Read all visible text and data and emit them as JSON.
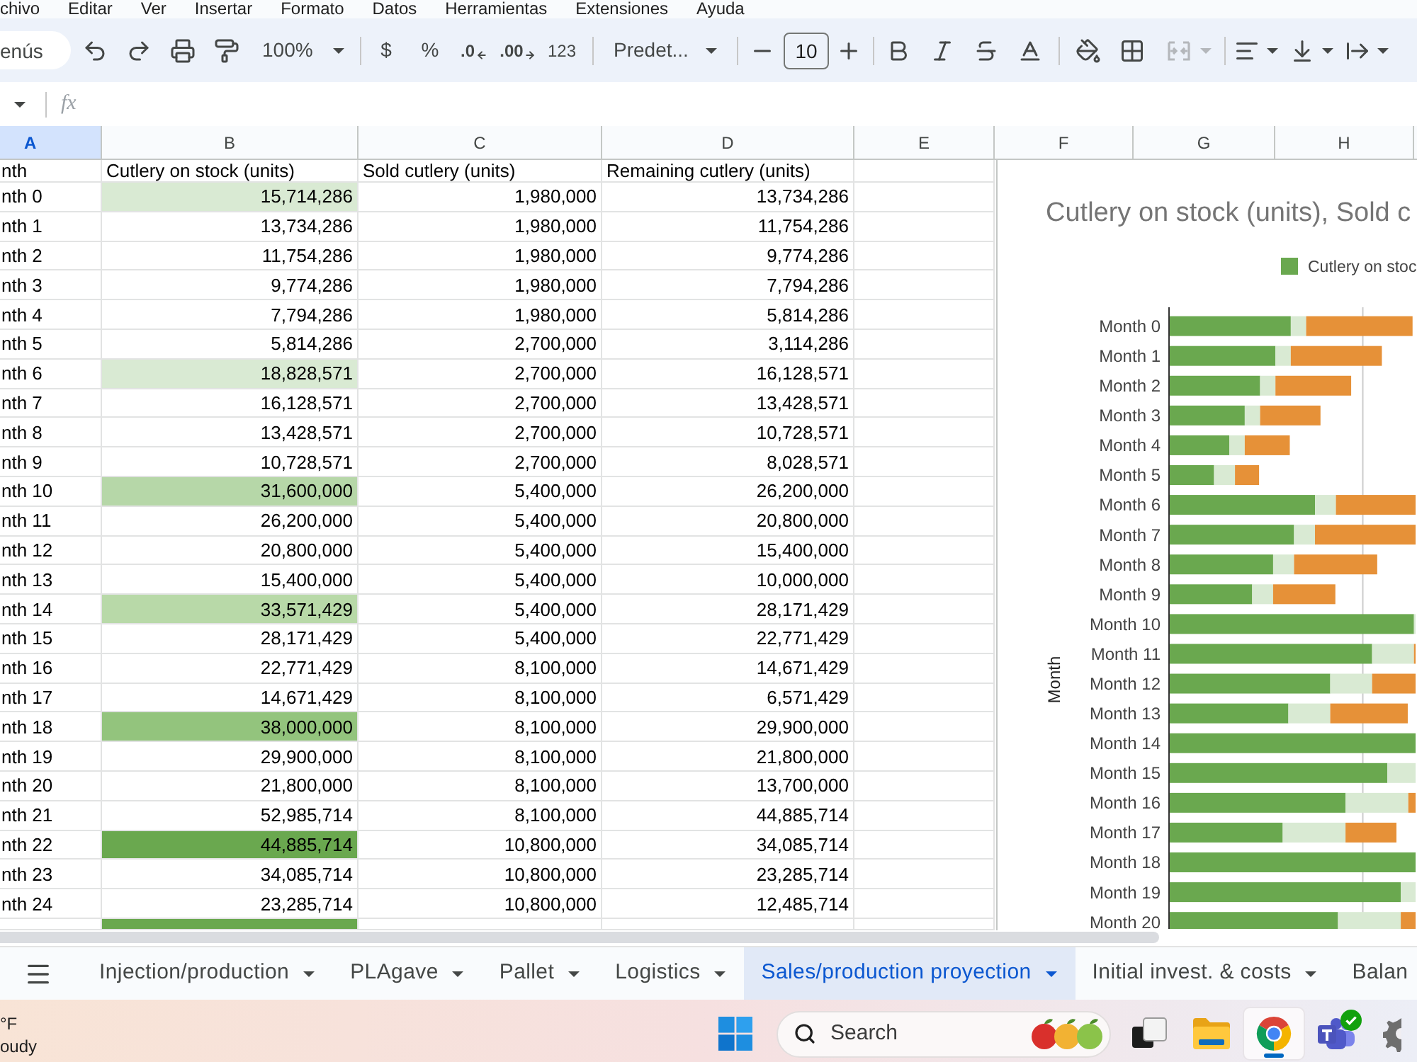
{
  "menu_bar": {
    "items": [
      "chivo",
      "Editar",
      "Ver",
      "Insertar",
      "Formato",
      "Datos",
      "Herramientas",
      "Extensiones",
      "Ayuda"
    ]
  },
  "toolbar": {
    "search": {
      "placeholder": "enús"
    },
    "zoom": "100%",
    "currency": "$",
    "percent": "%",
    "decrease_decimals": ".0",
    "increase_decimals": ".00",
    "number_format": "123",
    "font": "Predet...",
    "font_size": "10",
    "merge": {
      "disabled": true
    }
  },
  "formula_bar": {
    "label": "fx"
  },
  "sheet": {
    "columns": [
      {
        "label": "A",
        "selected": true
      },
      {
        "label": "B",
        "selected": false
      },
      {
        "label": "C",
        "selected": false
      },
      {
        "label": "D",
        "selected": false
      },
      {
        "label": "E",
        "selected": false
      },
      {
        "label": "F",
        "selected": false
      },
      {
        "label": "G",
        "selected": false
      },
      {
        "label": "H",
        "selected": false
      }
    ],
    "header": [
      "nth",
      "Cutlery on stock (units)",
      "Sold cutlery (units)",
      "Remaining cutlery (units)"
    ],
    "rows": [
      {
        "month": "nth 0",
        "stock": "15,714,286",
        "sold": "1,980,000",
        "remaining": "13,734,286",
        "color": "#d9ead3"
      },
      {
        "month": "nth 1",
        "stock": "13,734,286",
        "sold": "1,980,000",
        "remaining": "11,754,286"
      },
      {
        "month": "nth 2",
        "stock": "11,754,286",
        "sold": "1,980,000",
        "remaining": "9,774,286"
      },
      {
        "month": "nth 3",
        "stock": "9,774,286",
        "sold": "1,980,000",
        "remaining": "7,794,286"
      },
      {
        "month": "nth 4",
        "stock": "7,794,286",
        "sold": "1,980,000",
        "remaining": "5,814,286"
      },
      {
        "month": "nth 5",
        "stock": "5,814,286",
        "sold": "2,700,000",
        "remaining": "3,114,286"
      },
      {
        "month": "nth 6",
        "stock": "18,828,571",
        "sold": "2,700,000",
        "remaining": "16,128,571",
        "color": "#d9ead3"
      },
      {
        "month": "nth 7",
        "stock": "16,128,571",
        "sold": "2,700,000",
        "remaining": "13,428,571"
      },
      {
        "month": "nth 8",
        "stock": "13,428,571",
        "sold": "2,700,000",
        "remaining": "10,728,571"
      },
      {
        "month": "nth 9",
        "stock": "10,728,571",
        "sold": "2,700,000",
        "remaining": "8,028,571"
      },
      {
        "month": "nth 10",
        "stock": "31,600,000",
        "sold": "5,400,000",
        "remaining": "26,200,000",
        "color": "#b6d7a8"
      },
      {
        "month": "nth 11",
        "stock": "26,200,000",
        "sold": "5,400,000",
        "remaining": "20,800,000"
      },
      {
        "month": "nth 12",
        "stock": "20,800,000",
        "sold": "5,400,000",
        "remaining": "15,400,000"
      },
      {
        "month": "nth 13",
        "stock": "15,400,000",
        "sold": "5,400,000",
        "remaining": "10,000,000"
      },
      {
        "month": "nth 14",
        "stock": "33,571,429",
        "sold": "5,400,000",
        "remaining": "28,171,429",
        "color": "#b8d9a8"
      },
      {
        "month": "nth 15",
        "stock": "28,171,429",
        "sold": "5,400,000",
        "remaining": "22,771,429"
      },
      {
        "month": "nth 16",
        "stock": "22,771,429",
        "sold": "8,100,000",
        "remaining": "14,671,429"
      },
      {
        "month": "nth 17",
        "stock": "14,671,429",
        "sold": "8,100,000",
        "remaining": "6,571,429"
      },
      {
        "month": "nth 18",
        "stock": "38,000,000",
        "sold": "8,100,000",
        "remaining": "29,900,000",
        "color": "#93c47d"
      },
      {
        "month": "nth 19",
        "stock": "29,900,000",
        "sold": "8,100,000",
        "remaining": "21,800,000"
      },
      {
        "month": "nth 20",
        "stock": "21,800,000",
        "sold": "8,100,000",
        "remaining": "13,700,000"
      },
      {
        "month": "nth 21",
        "stock": "52,985,714",
        "sold": "8,100,000",
        "remaining": "44,885,714"
      },
      {
        "month": "nth 22",
        "stock": "44,885,714",
        "sold": "10,800,000",
        "remaining": "34,085,714",
        "color": "#6aa84f"
      },
      {
        "month": "nth 23",
        "stock": "34,085,714",
        "sold": "10,800,000",
        "remaining": "23,285,714"
      },
      {
        "month": "nth 24",
        "stock": "23,285,714",
        "sold": "10,800,000",
        "remaining": "12,485,714"
      },
      {
        "color": "#6aa84f"
      }
    ]
  },
  "chart": {
    "title": "Cutlery on stock (units), Sold c",
    "legend": [
      "Cutlery on stoc"
    ],
    "axis_label": "Month",
    "categories": [
      "Month 0",
      "Month 1",
      "Month 2",
      "Month 3",
      "Month 4",
      "Month 5",
      "Month 6",
      "Month 7",
      "Month 8",
      "Month 9",
      "Month 10",
      "Month 11",
      "Month 12",
      "Month 13",
      "Month 14",
      "Month 15",
      "Month 16",
      "Month 17",
      "Month 18",
      "Month 19",
      "Month 20"
    ]
  },
  "sheet_tabs": {
    "tabs": [
      {
        "label": "Injection/production",
        "selected": false
      },
      {
        "label": "PLAgave",
        "selected": false
      },
      {
        "label": "Pallet",
        "selected": false
      },
      {
        "label": "Logistics",
        "selected": false
      },
      {
        "label": "Sales/production proyection",
        "selected": true
      },
      {
        "label": "Initial invest. & costs",
        "selected": false
      },
      {
        "label": "Balan",
        "selected": false
      }
    ]
  },
  "taskbar": {
    "weather": {
      "temperature": "°F",
      "condition": "oudy"
    },
    "search": {
      "placeholder": "Search"
    },
    "apps": [
      {
        "kind": "task_view",
        "selected": false,
        "badge": false
      },
      {
        "kind": "file_explorer",
        "selected": false,
        "badge": false
      },
      {
        "kind": "browser",
        "selected": true,
        "badge": false
      },
      {
        "kind": "teams",
        "selected": false,
        "badge": true
      },
      {
        "kind": "settings",
        "selected": false,
        "badge": false
      }
    ]
  }
}
